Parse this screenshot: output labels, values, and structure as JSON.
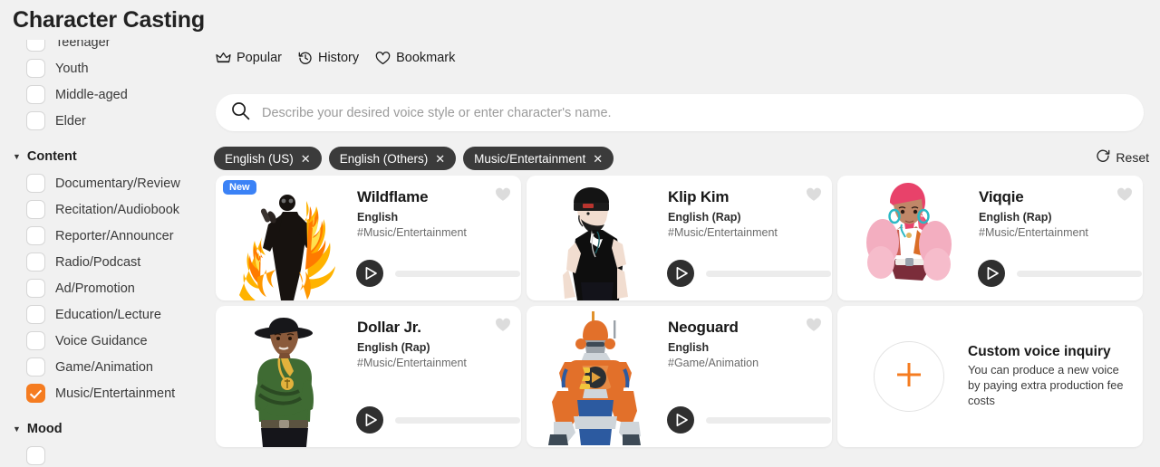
{
  "header": {
    "title": "Character Casting"
  },
  "sidebar": {
    "age_items": [
      {
        "label": "Teenager",
        "checked": false,
        "partial": true
      },
      {
        "label": "Youth",
        "checked": false
      },
      {
        "label": "Middle-aged",
        "checked": false
      },
      {
        "label": "Elder",
        "checked": false
      }
    ],
    "content_group": {
      "label": "Content",
      "expanded": true
    },
    "content_items": [
      {
        "label": "Documentary/Review",
        "checked": false
      },
      {
        "label": "Recitation/Audiobook",
        "checked": false
      },
      {
        "label": "Reporter/Announcer",
        "checked": false
      },
      {
        "label": "Radio/Podcast",
        "checked": false
      },
      {
        "label": "Ad/Promotion",
        "checked": false
      },
      {
        "label": "Education/Lecture",
        "checked": false
      },
      {
        "label": "Voice Guidance",
        "checked": false
      },
      {
        "label": "Game/Animation",
        "checked": false
      },
      {
        "label": "Music/Entertainment",
        "checked": true
      }
    ],
    "mood_group": {
      "label": "Mood",
      "expanded": true
    }
  },
  "quicknav": [
    {
      "label": "Popular",
      "icon": "crown-icon"
    },
    {
      "label": "History",
      "icon": "history-icon"
    },
    {
      "label": "Bookmark",
      "icon": "heart-outline-icon"
    }
  ],
  "search": {
    "placeholder": "Describe your desired voice style or enter character's name.",
    "value": "",
    "icon": "search-icon"
  },
  "filters": {
    "chips": [
      {
        "label": "English (US)"
      },
      {
        "label": "English (Others)"
      },
      {
        "label": "Music/Entertainment"
      }
    ],
    "reset_label": "Reset",
    "reset_icon": "reset-icon"
  },
  "cards": [
    {
      "name": "Wildflame",
      "language": "English",
      "tag": "#Music/Entertainment",
      "badge": "New",
      "art": "flame-singer"
    },
    {
      "name": "Klip Kim",
      "language": "English (Rap)",
      "tag": "#Music/Entertainment",
      "badge": "",
      "art": "beanie-rapper"
    },
    {
      "name": "Viqqie",
      "language": "English (Rap)",
      "tag": "#Music/Entertainment",
      "badge": "",
      "art": "pink-hair-woman"
    },
    {
      "name": "Dollar Jr.",
      "language": "English (Rap)",
      "tag": "#Music/Entertainment",
      "badge": "",
      "art": "green-jacket-man"
    },
    {
      "name": "Neoguard",
      "language": "English",
      "tag": "#Game/Animation",
      "badge": "",
      "art": "orange-mecha"
    }
  ],
  "custom_card": {
    "title": "Custom voice inquiry",
    "description": "You can produce a new voice by paying extra production fee costs",
    "icon": "plus-icon"
  },
  "colors": {
    "accent": "#f57c20",
    "badge_new": "#3b82f6",
    "chip_bg": "#3b3b3b",
    "page_bg": "#f1f1f1",
    "card_bg": "#ffffff"
  }
}
